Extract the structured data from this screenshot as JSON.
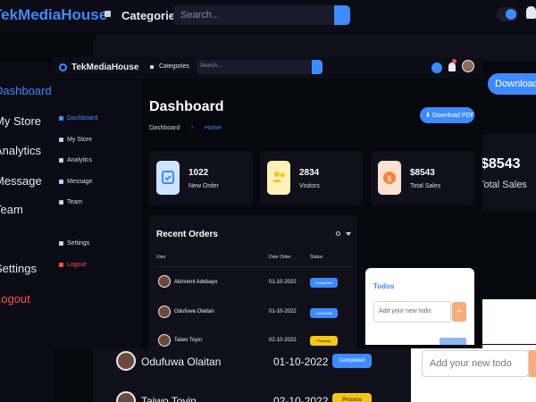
{
  "app": {
    "brand": "TekMediaHouse",
    "categories_label": "Categories",
    "search_placeholder": "Search..."
  },
  "background": {
    "sidebar": [
      "Dashboard",
      "My Store",
      "Analytics",
      "Message",
      "Team",
      "Settings",
      "Logout"
    ],
    "download_label": "Download",
    "sales_value": "$8543",
    "sales_label": "Total Sales",
    "todo_placeholder": "Add your new todo",
    "orders": [
      {
        "name": "Odufuwa Olaitan",
        "date": "01-10-2022",
        "status": "Completed"
      },
      {
        "name": "Taiwo Toyin",
        "date": "02-10-2022",
        "status": "Process"
      }
    ]
  },
  "sidebar": {
    "items": [
      {
        "label": "Dashboard",
        "icon": "grid-icon"
      },
      {
        "label": "My Store",
        "icon": "store-icon"
      },
      {
        "label": "Analytics",
        "icon": "chart-icon"
      },
      {
        "label": "Message",
        "icon": "message-icon"
      },
      {
        "label": "Team",
        "icon": "team-icon"
      }
    ],
    "settings_label": "Settings",
    "logout_label": "Logout"
  },
  "main": {
    "title": "Dashboard",
    "breadcrumb": [
      "Dashboard",
      "Home"
    ],
    "download_label": "Download PDF",
    "cards": [
      {
        "value": "1022",
        "label": "New Order",
        "icon": "calendar-check-icon",
        "icon_bg": "#cfe4ff",
        "icon_color": "#3d8bff"
      },
      {
        "value": "2834",
        "label": "Visitors",
        "icon": "people-icon",
        "icon_bg": "#fff1b8",
        "icon_color": "#f5c518"
      },
      {
        "value": "$8543",
        "label": "Total Sales",
        "icon": "dollar-icon",
        "icon_bg": "#ffe1d1",
        "icon_color": "#f2843f"
      }
    ],
    "recent_orders": {
      "title": "Recent Orders",
      "headers": [
        "User",
        "Date Order",
        "Status"
      ],
      "rows": [
        {
          "name": "Akinremi Adebayo",
          "date": "01-10-2022",
          "status": "Completed"
        },
        {
          "name": "Odufuwa Olaitan",
          "date": "01-10-2022",
          "status": "Completed"
        },
        {
          "name": "Taiwo Toyin",
          "date": "02-10-2022",
          "status": "Process"
        }
      ]
    },
    "todos": {
      "title": "Todos",
      "placeholder": "Add your new todo",
      "add_symbol": "+"
    }
  },
  "colors": {
    "accent": "#3d8bff",
    "logout": "#ff4d4f",
    "completed": "#3d8bff",
    "process": "#f5c518"
  }
}
